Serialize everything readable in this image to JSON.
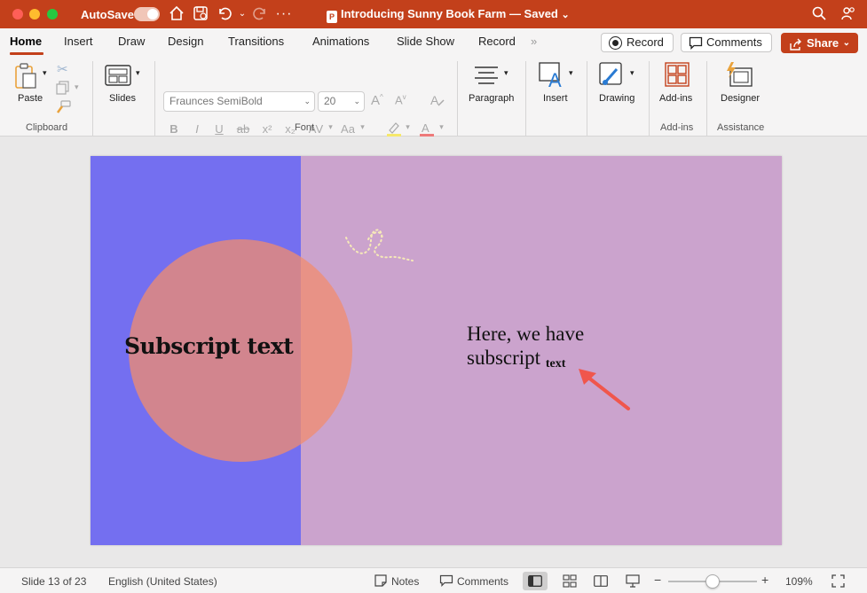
{
  "titlebar": {
    "autosave_label": "AutoSave",
    "doc_title": "Introducing Sunny Book Farm — Saved",
    "doc_chevron": "⌄",
    "icons": [
      "home-icon",
      "save-icon",
      "undo-icon",
      "redo-icon",
      "more-icon",
      "search-icon",
      "share-people-icon"
    ]
  },
  "tabs": [
    {
      "label": "Home"
    },
    {
      "label": "Insert"
    },
    {
      "label": "Draw"
    },
    {
      "label": "Design"
    },
    {
      "label": "Transitions"
    },
    {
      "label": "Animations"
    },
    {
      "label": "Slide Show"
    },
    {
      "label": "Record"
    }
  ],
  "tab_overflow": "»",
  "actions": {
    "record": "Record",
    "comments": "Comments",
    "share": "Share"
  },
  "ribbon": {
    "paste": "Paste",
    "slides": "Slides",
    "font_name": "Fraunces SemiBold",
    "font_size": "20",
    "paragraph": "Paragraph",
    "insert": "Insert",
    "drawing": "Drawing",
    "addins": "Add-ins",
    "designer": "Designer",
    "groups": {
      "clipboard": "Clipboard",
      "font": "Font",
      "addins": "Add-ins",
      "assistance": "Assistance"
    },
    "format_buttons": [
      "B",
      "I",
      "U",
      "ab",
      "x²",
      "x₂",
      "AV",
      "Aa"
    ],
    "grow_font": "A",
    "shrink_font": "A"
  },
  "slide": {
    "left_text": "Subscript text",
    "right_line1": "Here, we have",
    "right_line2": "subscript",
    "right_sub": "text",
    "colors": {
      "left_panel": "#746ff0",
      "background": "#cba3cd",
      "circle": "#f28c6e",
      "arrow": "#f0564c"
    }
  },
  "status": {
    "slide_counter": "Slide 13 of 23",
    "language": "English (United States)",
    "notes": "Notes",
    "comments": "Comments",
    "zoom_minus": "−",
    "zoom_plus": "+",
    "zoom": "109%"
  }
}
